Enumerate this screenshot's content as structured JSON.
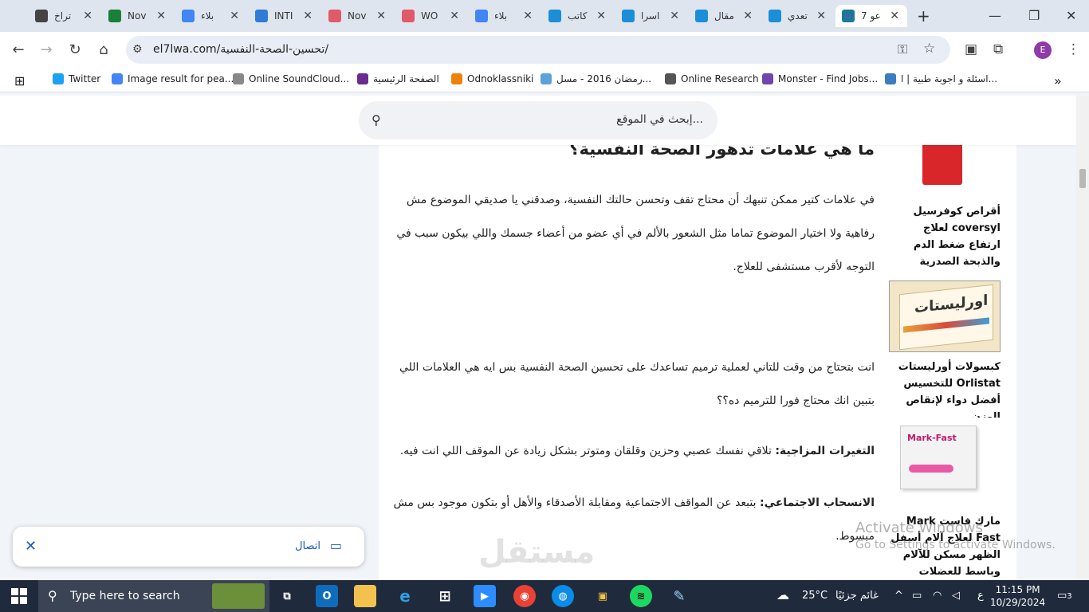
{
  "browser": {
    "tabs": [
      {
        "title": "تراخ",
        "favicon": "openai-icon",
        "color": "#444444"
      },
      {
        "title": "Nov",
        "favicon": "sheets-plus-icon",
        "color": "#188038"
      },
      {
        "title": "بلاء",
        "favicon": "docs-icon",
        "color": "#4285f4"
      },
      {
        "title": "INTI",
        "favicon": "translate-icon",
        "color": "#2f7bd6"
      },
      {
        "title": "Nov",
        "favicon": "wave-icon",
        "color": "#e05a6a"
      },
      {
        "title": "WO",
        "favicon": "wave-icon",
        "color": "#e05a6a"
      },
      {
        "title": "بلاء",
        "favicon": "docs-icon",
        "color": "#4285f4"
      },
      {
        "title": "كاتب",
        "favicon": "circle-icon",
        "color": "#1a8fd8"
      },
      {
        "title": "اسرا",
        "favicon": "circle-icon",
        "color": "#1a8fd8"
      },
      {
        "title": "مقال",
        "favicon": "circle-icon",
        "color": "#1a8fd8"
      },
      {
        "title": "تعدي",
        "favicon": "circle-icon",
        "color": "#1a8fd8"
      },
      {
        "title": "7 عو",
        "favicon": "wordpress-icon",
        "color": "#21759b",
        "active": true
      }
    ],
    "url": "el7lwa.com/تحسين-الصحة-النفسية/",
    "profile_letter": "E",
    "bookmarks": [
      {
        "label": "Twitter",
        "icon": "twitter-icon",
        "color": "#1da1f2"
      },
      {
        "label": "Image result for pea...",
        "icon": "google-icon",
        "color": "#4285f4"
      },
      {
        "label": "Online SoundCloud...",
        "icon": "soundcloud-icon",
        "color": "#888888"
      },
      {
        "label": "الصفحة الرئيسية",
        "icon": "feather-icon",
        "color": "#6b2a8f"
      },
      {
        "label": "Odnoklassniki",
        "icon": "ok-icon",
        "color": "#ee8208"
      },
      {
        "label": "رمضان 2016 - مسل...",
        "icon": "film-icon",
        "color": "#5ba3d9"
      },
      {
        "label": "Online Research",
        "icon": "globe-icon",
        "color": "#555555"
      },
      {
        "label": "Monster - Find Jobs...",
        "icon": "monster-icon",
        "color": "#6e46ae"
      },
      {
        "label": "اسئلة و اجوبة طبية | ا...",
        "icon": "qa-icon",
        "color": "#3b7bbf"
      }
    ]
  },
  "site": {
    "search_placeholder": "إبحث في الموقع..."
  },
  "article": {
    "heading": "ما هي علامات تدهور الصحة النفسية؟",
    "para1": "في علامات كتير ممكن تنبهك أن محتاج تقف وتحسن حالتك النفسية، وصدقني يا صديقي الموضوع مش رفاهية ولا اختيار الموضوع تماما مثل الشعور بالألم في أي عضو من أعضاء جسمك واللي بيكون سبب في التوجه لأقرب مستشفى للعلاج.",
    "para2": "انت بتحتاج من وقت للتاني لعملية ترميم تساعدك على تحسين الصحة النفسية بس ايه هي العلامات اللي بتبين انك محتاج فورا للترميم ده؟؟",
    "p3_label": "التغيرات المزاجية:",
    "p3_text": " تلاقي نفسك عصبي وحزين وقلقان ومتوتر بشكل زيادة عن الموقف اللي انت فيه.",
    "p4_label": "الانسحاب الاجتماعي:",
    "p4_text": " بتبعد عن المواقف الاجتماعية ومقابلة الأصدقاء والأهل أو بتكون موجود بس مش مبسوط."
  },
  "sidebar": [
    {
      "caption": "أقراص كوفرسيل coversyl لعلاج ارتفاع ضغط الدم والذبحة الصدرية",
      "product_label": ""
    },
    {
      "caption": "كبسولات أورليستات Orlistat للتخسيس أفضل دواء لإنقاص الوزن",
      "product_label": "اورليستات"
    },
    {
      "caption": "مارك فاست Mark Fast لعلاج آلام أسفل الظهر مسكن للآلام وباسط للعضلات",
      "product_label": "Mark-Fast"
    }
  ],
  "cast_bar": {
    "label": "اتصال"
  },
  "overlay": {
    "activate_line1": "Activate Windows",
    "activate_line2": "Go to Settings to activate Windows.",
    "watermark": "مستقل"
  },
  "taskbar": {
    "search_text": "Type here to search",
    "weather_temp": "25°C",
    "weather_text": "غائم جزئيًا",
    "lang": "ع",
    "time": "11:15 PM",
    "date": "10/29/2024",
    "notifications": "3"
  }
}
